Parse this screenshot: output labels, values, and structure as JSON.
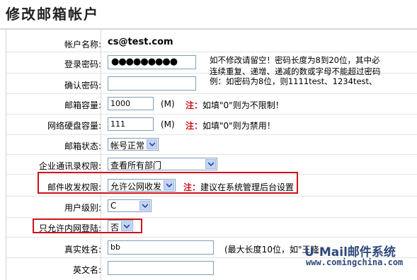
{
  "page": {
    "title": "修改邮箱帐户"
  },
  "form": {
    "account": {
      "label": "帐户名称:",
      "value": "cs@test.com"
    },
    "password": {
      "label": "登录密码:",
      "value": "●●●●●●●●●"
    },
    "password_hint": {
      "line1": "如不修改请留空！密码长度为8到20位，其中必",
      "line2": "连续重复、递增、递减的数或字母不能超过密码",
      "line3": "例：如密码为8位，则1111test、1234test、"
    },
    "confirm": {
      "label": "确认密码:",
      "value": ""
    },
    "mailbox_quota": {
      "label": "邮箱容量:",
      "value": "1000",
      "unit": "(M)",
      "note_prefix": "注：",
      "note": "如填\"0\"则为不限制！"
    },
    "disk_quota": {
      "label": "网络硬盘容量:",
      "value": "111",
      "unit": "(M)",
      "note_prefix": "注：",
      "note": "如填\"0\"则为禁用！"
    },
    "status": {
      "label": "邮箱状态:",
      "value": "帐号正常"
    },
    "directory": {
      "label": "企业通讯录权限:",
      "value": "查看所有部门"
    },
    "mail_permission": {
      "label": "邮件收发权限:",
      "value": "允许公网收发",
      "note_prefix": "注：",
      "note": "建议在系统管理后台设置"
    },
    "user_level": {
      "label": "用户级别:",
      "value": "C"
    },
    "intranet_only": {
      "label": "只允许内网登陆:",
      "value": "否"
    },
    "real_name": {
      "label": "真实姓名:",
      "value": "bb",
      "hint": "(最大长度10位，如\"王晓"
    },
    "english_name": {
      "label": "英文名:",
      "value": ""
    }
  },
  "watermark": {
    "line1": "U-Mail邮件系统",
    "line2": "www.comingchina.com"
  },
  "colors": {
    "highlight": "#d0101a",
    "field_border": "#7f9db9",
    "select_arrow": "#c3d4f7"
  }
}
